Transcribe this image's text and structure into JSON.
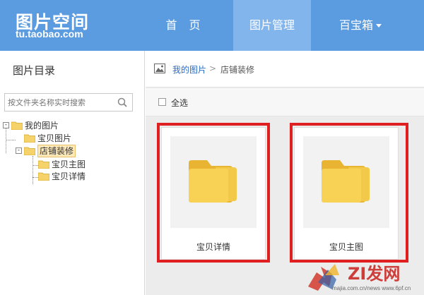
{
  "header": {
    "logo_cn": "图片空间",
    "logo_en": "tu.taobao.com",
    "nav": [
      {
        "label": "首 页"
      },
      {
        "label": "图片管理"
      },
      {
        "label": "百宝箱"
      }
    ]
  },
  "sidebar": {
    "title": "图片目录",
    "search": {
      "placeholder": "按文件夹名称实时搜索",
      "icon": "search-icon"
    },
    "tree": [
      {
        "label": "我的图片",
        "toggle": "-"
      },
      {
        "label": "宝贝图片"
      },
      {
        "label": "店铺装修",
        "toggle": "-",
        "selected": true
      },
      {
        "label": "宝贝主图"
      },
      {
        "label": "宝贝详情"
      }
    ]
  },
  "main": {
    "breadcrumb": {
      "link": "我的图片",
      "separator": ">",
      "current": "店铺装修",
      "icon": "image-icon"
    },
    "toolbar": {
      "select_all": "全选"
    },
    "cards": [
      {
        "label": "宝贝详情"
      },
      {
        "label": "宝贝主图"
      }
    ]
  },
  "watermark": {
    "text": "ZI发网",
    "url": "majia.com.cn/news www.6pf.cn"
  },
  "colors": {
    "header": "#5b9be0",
    "nav_active": "#82b5ec",
    "folder": "#f6c94c",
    "highlight": "#e02020",
    "link": "#2a6cc2"
  }
}
